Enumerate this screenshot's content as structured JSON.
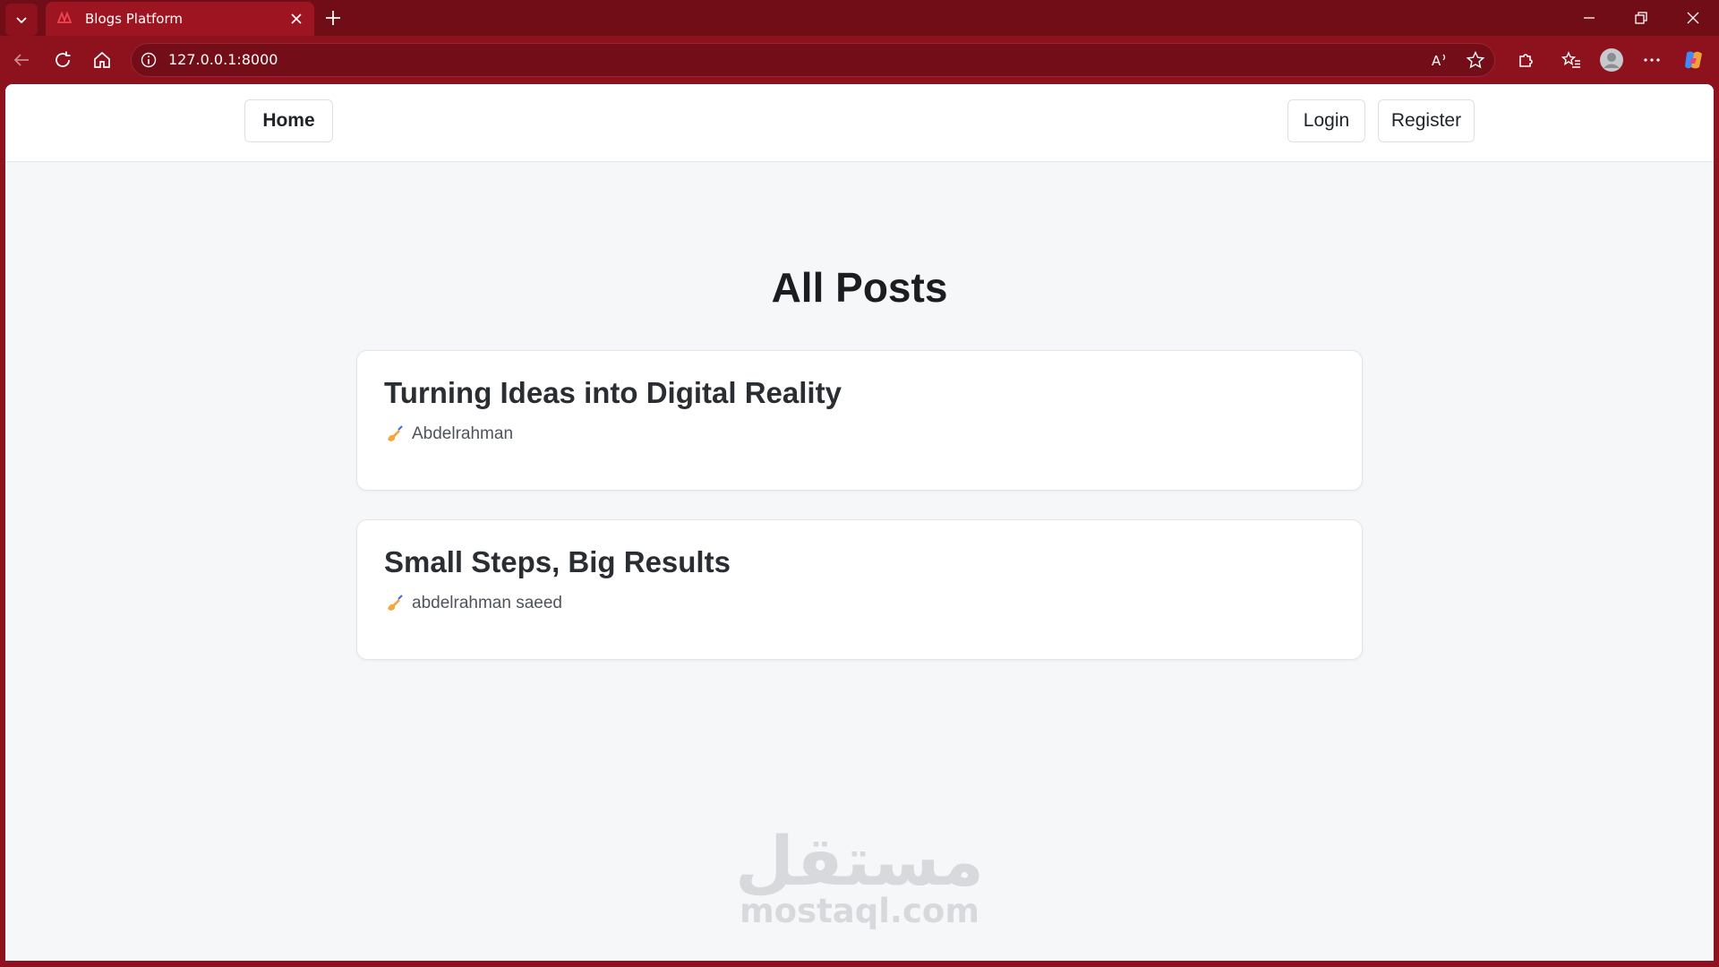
{
  "browser": {
    "tab_title": "Blogs Platform",
    "url": "127.0.0.1:8000"
  },
  "nav": {
    "home_label": "Home",
    "login_label": "Login",
    "register_label": "Register"
  },
  "main": {
    "heading": "All Posts",
    "posts": [
      {
        "title": "Turning Ideas into Digital Reality",
        "author": "Abdelrahman"
      },
      {
        "title": "Small Steps, Big Results",
        "author": "abdelrahman saeed"
      }
    ]
  },
  "watermark": {
    "logo_text": "مستقل",
    "domain": "mostaql.com"
  },
  "colors": {
    "browser_frame": "#8d121e",
    "tab_strip": "#710d16",
    "page_background": "#f6f7f9",
    "card_background": "#ffffff"
  },
  "icons": {
    "author": "writing-hand-icon"
  }
}
